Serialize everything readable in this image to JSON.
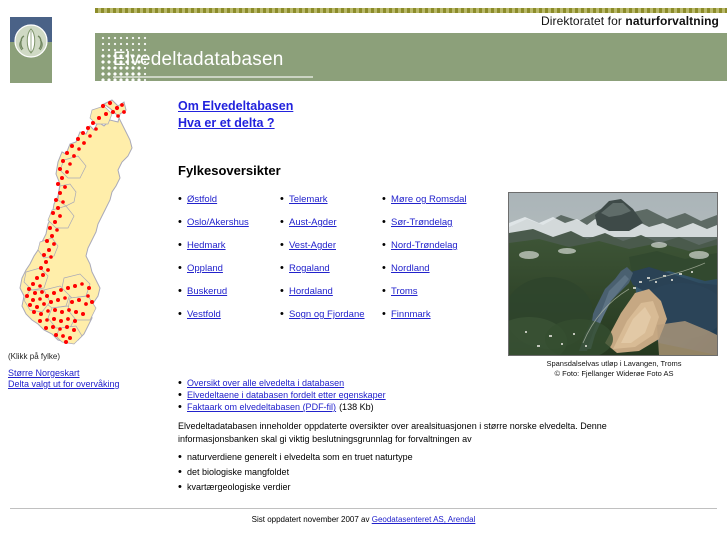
{
  "header": {
    "agency_prefix": "Direktoratet for ",
    "agency_name": "naturforvaltning",
    "title": "Elvedeltadatabasen",
    "logo_icon": "plant-in-circle-logo"
  },
  "sidebar": {
    "map_alt": "norway-map-with-delta-points",
    "hint": "(Klikk på fylke)",
    "links": [
      {
        "label": "Større Norgeskart"
      },
      {
        "label": "Delta valgt ut for overvåking"
      }
    ]
  },
  "main": {
    "top_links": [
      {
        "label": "Om Elvedeltabasen"
      },
      {
        "label": "Hva er et delta ?"
      }
    ],
    "section_title": "Fylkesoversikter",
    "county_columns": [
      [
        {
          "label": "Østfold"
        },
        {
          "label": "Oslo/Akershus"
        },
        {
          "label": "Hedmark"
        },
        {
          "label": "Oppland"
        },
        {
          "label": "Buskerud"
        },
        {
          "label": "Vestfold"
        }
      ],
      [
        {
          "label": "Telemark"
        },
        {
          "label": "Aust-Agder"
        },
        {
          "label": "Vest-Agder"
        },
        {
          "label": "Rogaland"
        },
        {
          "label": "Hordaland"
        },
        {
          "label": "Sogn og Fjordane"
        }
      ],
      [
        {
          "label": "Møre og Romsdal"
        },
        {
          "label": "Sør-Trøndelag"
        },
        {
          "label": "Nord-Trøndelag"
        },
        {
          "label": "Nordland"
        },
        {
          "label": "Troms"
        },
        {
          "label": "Finnmark"
        }
      ]
    ],
    "bottom_links": [
      {
        "label": "Oversikt over alle elvedelta i databasen",
        "note": ""
      },
      {
        "label": "Elvedeltaene i databasen fordelt etter egenskaper",
        "note": ""
      },
      {
        "label": "Faktaark om elvedeltabasen (PDF-fil)",
        "note": "(138 Kb)"
      }
    ],
    "paragraph": "Elvedeltadatabasen inneholder oppdaterte oversikter over arealsituasjonen i større norske elvedelta. Denne informasjonsbanken skal gi viktig beslutningsgrunnlag for forvaltningen av",
    "value_bullets": [
      {
        "label": "naturverdiene generelt i elvedelta som en truet naturtype"
      },
      {
        "label": "det biologiske mangfoldet"
      },
      {
        "label": "kvartærgeologiske verdier"
      }
    ]
  },
  "photo": {
    "alt": "aerial-photo-river-delta",
    "caption_line1": "Spansdalselvas utløp i Lavangen, Troms",
    "caption_line2": "© Foto: Fjellanger Widerøe Foto AS"
  },
  "footer": {
    "text_prefix": "Sist oppdatert november 2007 av ",
    "link_label": "Geodatasenteret AS, Arendal"
  },
  "colors": {
    "header_green": "#8ca07a",
    "logo_blue": "#4a6287",
    "topbar_olive": "#8c8c2a",
    "link_blue": "#2222cc",
    "map_fill": "#ffeeaa",
    "map_point": "#ff0000"
  }
}
